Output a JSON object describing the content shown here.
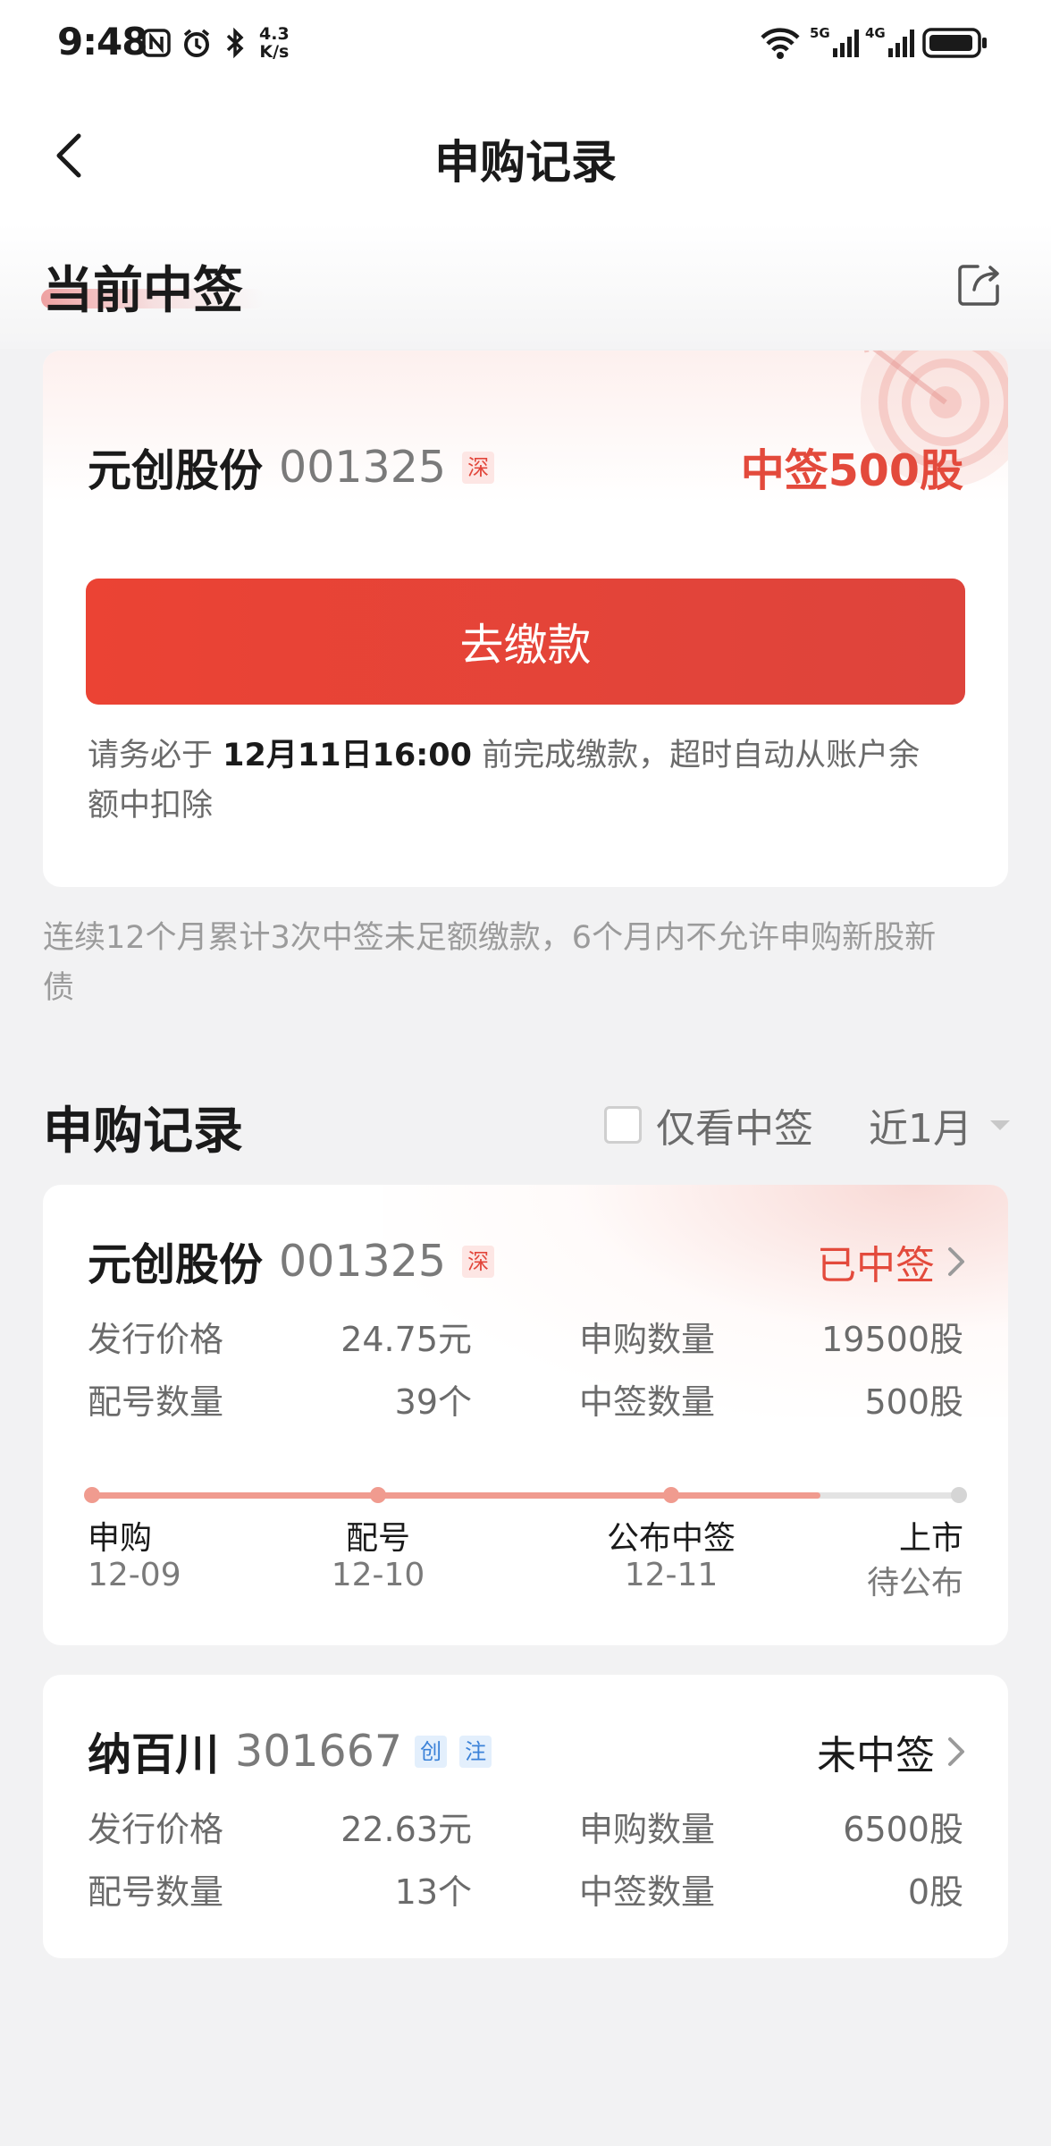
{
  "status_bar": {
    "time": "9:48",
    "net_speed_value": "4.3",
    "net_speed_unit": "K/s",
    "signal1": "5G",
    "signal2": "4G"
  },
  "header": {
    "title": "申购记录"
  },
  "current_win": {
    "section_title": "当前中签",
    "stock_name": "元创股份",
    "stock_code": "001325",
    "market_tag": "深",
    "win_label": "中签500股",
    "pay_button": "去缴款",
    "notice_prefix": "请务必于 ",
    "notice_deadline": "12月11日16:00",
    "notice_suffix_line1": " 前完成缴款，超时自动从账户余",
    "notice_line2": "额中扣除"
  },
  "warning_note": {
    "line1": "连续12个月累计3次中签未足额缴款，6个月内不允许申购新股新",
    "line2": "债"
  },
  "records": {
    "section_title": "申购记录",
    "filter_only_won": "仅看中签",
    "period": "近1月",
    "items": [
      {
        "stock_name": "元创股份",
        "stock_code": "001325",
        "tags": [
          "深"
        ],
        "status": "已中签",
        "issue_price_label": "发行价格",
        "issue_price": "24.75元",
        "subscribe_qty_label": "申购数量",
        "subscribe_qty": "19500股",
        "allot_count_label": "配号数量",
        "allot_count": "39个",
        "win_qty_label": "中签数量",
        "win_qty": "500股",
        "timeline": [
          {
            "label": "申购",
            "date": "12-09"
          },
          {
            "label": "配号",
            "date": "12-10"
          },
          {
            "label": "公布中签",
            "date": "12-11"
          },
          {
            "label": "上市",
            "date": "待公布"
          }
        ],
        "timeline_progress": 0.84
      },
      {
        "stock_name": "纳百川",
        "stock_code": "301667",
        "tags": [
          "创",
          "注"
        ],
        "status": "未中签",
        "issue_price_label": "发行价格",
        "issue_price": "22.63元",
        "subscribe_qty_label": "申购数量",
        "subscribe_qty": "6500股",
        "allot_count_label": "配号数量",
        "allot_count": "13个",
        "win_qty_label": "中签数量",
        "win_qty": "0股"
      }
    ]
  },
  "colors": {
    "accent_red": "#e34a3c",
    "button_red": "#eb4334",
    "timeline_active": "#f09b8f",
    "background": "#f2f2f3"
  },
  "icons": {
    "back": "back-arrow-icon",
    "share": "share-icon",
    "target": "target-icon",
    "chevron": "chevron-right-icon",
    "dropdown": "triangle-down-icon"
  }
}
